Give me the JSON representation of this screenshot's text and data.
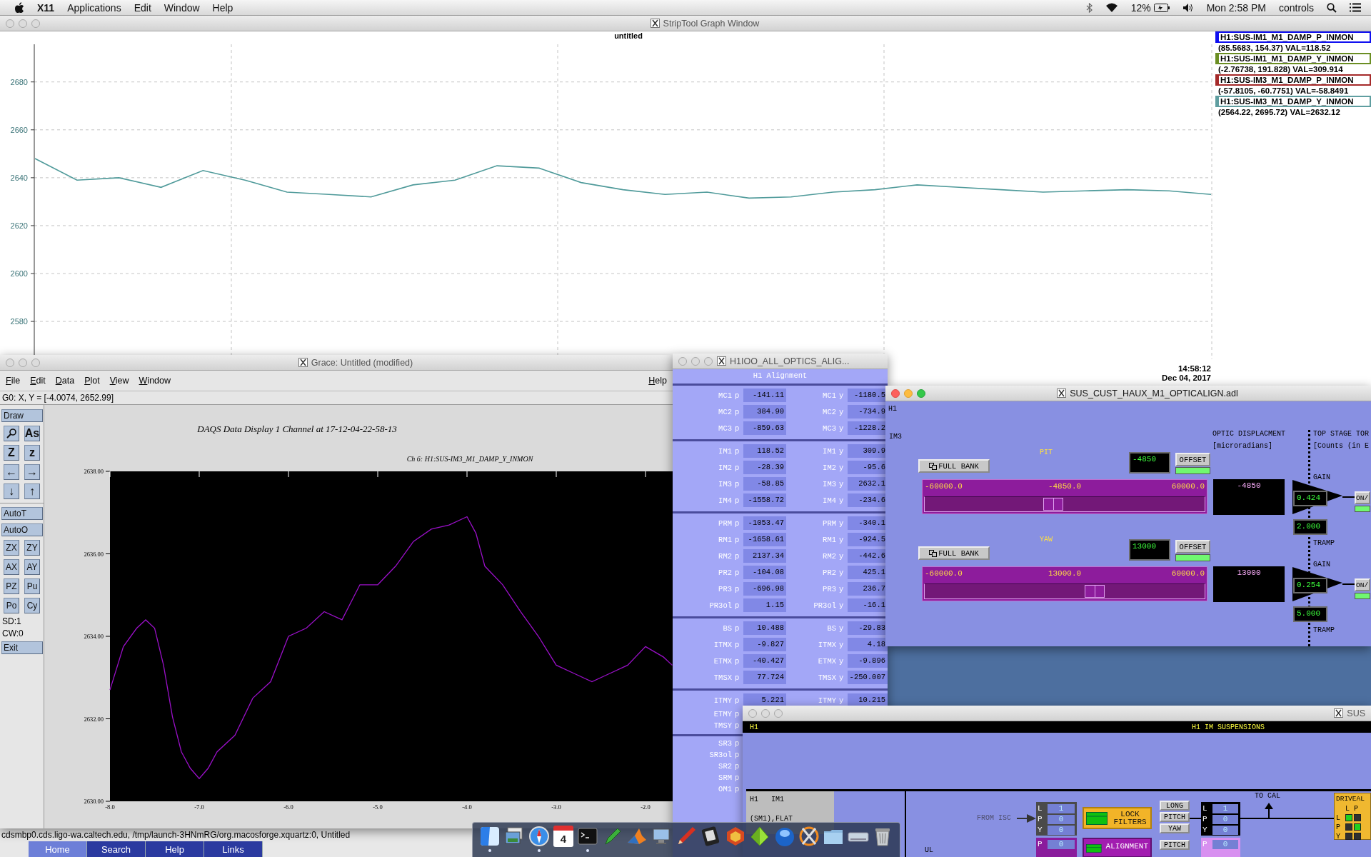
{
  "menu_bar": {
    "app": "X11",
    "menus": [
      "Applications",
      "Edit",
      "Window",
      "Help"
    ],
    "battery": "12%",
    "clock": "Mon 2:58 PM",
    "user": "controls"
  },
  "strip_tool": {
    "title": "StripTool Graph Window",
    "active": false,
    "subtitle": "untitled",
    "timestamp": "14:58:12",
    "date": "Dec 04, 2017",
    "chart_data": {
      "type": "line",
      "grid": true,
      "ylim": [
        2564.22,
        2695.72
      ],
      "yticks": [
        2580,
        2600,
        2620,
        2640,
        2660,
        2680
      ],
      "series": [
        {
          "color": "#4f9a9a",
          "values": [
            2648,
            2639,
            2640,
            2636,
            2643,
            2639,
            2634,
            2633,
            2632,
            2637,
            2639,
            2645,
            2644,
            2638,
            2635,
            2633,
            2634,
            2631.5,
            2632,
            2634,
            2635,
            2637,
            2636,
            2635,
            2634,
            2634.5,
            2635,
            2634.5,
            2633
          ]
        }
      ]
    },
    "legend": [
      {
        "name": "H1:SUS-IM1_M1_DAMP_P_INMON",
        "color": "#1010f0",
        "reading": "(85.5683, 154.37) VAL=118.52"
      },
      {
        "name": "H1:SUS-IM1_M1_DAMP_Y_INMON",
        "color": "#6b8e23",
        "reading": "(-2.76738, 191.828) VAL=309.914"
      },
      {
        "name": "H1:SUS-IM3_M1_DAMP_P_INMON",
        "color": "#a52a2a",
        "reading": "(-57.8105, -60.7751) VAL=-58.8491"
      },
      {
        "name": "H1:SUS-IM3_M1_DAMP_Y_INMON",
        "color": "#5f9ea0",
        "reading": "(2564.22, 2695.72) VAL=2632.12"
      }
    ]
  },
  "grace": {
    "title": "Grace: Untitled (modified)",
    "active": false,
    "menus": [
      "File",
      "Edit",
      "Data",
      "Plot",
      "View",
      "Window"
    ],
    "help": "Help",
    "coords": "G0: X, Y = [-4.0074, 2652.99]",
    "tools": [
      {
        "kind": "wide",
        "label": "Draw"
      },
      {
        "kind": "magnifier"
      },
      {
        "kind": "square",
        "label": "As"
      },
      {
        "kind": "square",
        "label": "Z"
      },
      {
        "kind": "square",
        "label": "z"
      },
      {
        "kind": "square",
        "label": "←"
      },
      {
        "kind": "square",
        "label": "→"
      },
      {
        "kind": "square",
        "label": "↓"
      },
      {
        "kind": "square",
        "label": "↑"
      },
      {
        "kind": "divider"
      },
      {
        "kind": "wide",
        "label": "AutoT"
      },
      {
        "kind": "wide",
        "label": "AutoO"
      },
      {
        "kind": "small",
        "label": "ZX"
      },
      {
        "kind": "small",
        "label": "ZY"
      },
      {
        "kind": "small",
        "label": "AX"
      },
      {
        "kind": "small",
        "label": "AY"
      },
      {
        "kind": "small",
        "label": "PZ"
      },
      {
        "kind": "small",
        "label": "Pu"
      },
      {
        "kind": "small",
        "label": "Po"
      },
      {
        "kind": "small",
        "label": "Cy"
      },
      {
        "kind": "info",
        "label": "SD:1"
      },
      {
        "kind": "info",
        "label": "CW:0"
      },
      {
        "kind": "wide",
        "label": "Exit"
      }
    ],
    "chart_data": {
      "type": "line",
      "title": "DAQS Data Display 1 Channel at 17-12-04-22-58-13",
      "xlim": [
        -8,
        -1.696
      ],
      "ylim": [
        2630,
        2638
      ],
      "xticks": [
        {
          "value": -8,
          "label": "-8.0"
        },
        {
          "value": -7,
          "label": "-7.0"
        },
        {
          "value": -6,
          "label": "-6.0"
        },
        {
          "value": -5,
          "label": "-5.0"
        },
        {
          "value": -4,
          "label": "-4.0"
        },
        {
          "value": -3,
          "label": "-3.0"
        },
        {
          "value": -2,
          "label": "-2.0"
        }
      ],
      "yticks": [
        {
          "value": 2630,
          "label": "2630.00"
        },
        {
          "value": 2632,
          "label": "2632.00"
        },
        {
          "value": 2634,
          "label": "2634.00"
        },
        {
          "value": 2636,
          "label": "2636.00"
        },
        {
          "value": 2638,
          "label": "2638.00"
        }
      ],
      "x": [
        -8,
        -7.85,
        -7.7,
        -7.6,
        -7.5,
        -7.4,
        -7.3,
        -7.2,
        -7.1,
        -7,
        -6.9,
        -6.8,
        -6.6,
        -6.4,
        -6.2,
        -6,
        -5.8,
        -5.6,
        -5.4,
        -5.2,
        -5,
        -4.8,
        -4.6,
        -4.4,
        -4.2,
        -4,
        -3.9,
        -3.8,
        -3.6,
        -3.4,
        -3.2,
        -3,
        -2.8,
        -2.6,
        -2.4,
        -2.2,
        -2,
        -1.8,
        -1.7
      ],
      "series": [
        {
          "name": "Ch 6:  H1:SUS-IM3_M1_DAMP_Y_INMON",
          "color": "#9a10c8",
          "values": [
            2632.7,
            2633.75,
            2634.2,
            2634.4,
            2634.2,
            2633.3,
            2632.05,
            2631.2,
            2630.8,
            2630.55,
            2630.8,
            2631.2,
            2631.6,
            2632.5,
            2632.9,
            2634,
            2634.2,
            2634.6,
            2634.4,
            2635.25,
            2635.25,
            2635.7,
            2636.3,
            2636.6,
            2636.7,
            2636.9,
            2636.5,
            2635.7,
            2635.25,
            2634.6,
            2634,
            2633.3,
            2633.1,
            2632.9,
            2633.1,
            2633.3,
            2633.75,
            2633.5,
            2633.3
          ]
        }
      ]
    }
  },
  "background_window": {
    "status": "cdsmbp0.cds.ligo-wa.caltech.edu, /tmp/launch-3HNmRG/org.macosforge.xquartz:0, Untitled",
    "nav": [
      {
        "label": "Home",
        "selected": true
      },
      {
        "label": "Search",
        "selected": false
      },
      {
        "label": "Help",
        "selected": false
      },
      {
        "label": "Links",
        "selected": false
      }
    ]
  },
  "alignment": {
    "title": "H1IOO_ALL_OPTICS_ALIG...",
    "active": false,
    "header": "H1 Alignment",
    "groups": [
      [
        {
          "cells": [
            {
              "label": "MC1",
              "axis": "p",
              "value": "-141.11"
            },
            {
              "label": "MC1",
              "axis": "y",
              "value": "-1180.5"
            }
          ]
        },
        {
          "cells": [
            {
              "label": "MC2",
              "axis": "p",
              "value": "384.90"
            },
            {
              "label": "MC2",
              "axis": "y",
              "value": "-734.9"
            }
          ]
        },
        {
          "cells": [
            {
              "label": "MC3",
              "axis": "p",
              "value": "-859.63"
            },
            {
              "label": "MC3",
              "axis": "y",
              "value": "-1228.2"
            }
          ]
        }
      ],
      [
        {
          "cells": [
            {
              "label": "IM1",
              "axis": "p",
              "value": "118.52"
            },
            {
              "label": "IM1",
              "axis": "y",
              "value": "309.9"
            }
          ]
        },
        {
          "cells": [
            {
              "label": "IM2",
              "axis": "p",
              "value": "-28.39"
            },
            {
              "label": "IM2",
              "axis": "y",
              "value": "-95.6"
            }
          ]
        },
        {
          "cells": [
            {
              "label": "IM3",
              "axis": "p",
              "value": "-58.85"
            },
            {
              "label": "IM3",
              "axis": "y",
              "value": "2632.1"
            }
          ]
        },
        {
          "cells": [
            {
              "label": "IM4",
              "axis": "p",
              "value": "-1558.72"
            },
            {
              "label": "IM4",
              "axis": "y",
              "value": "-234.6"
            }
          ]
        }
      ],
      [
        {
          "cells": [
            {
              "label": "PRM",
              "axis": "p",
              "value": "-1053.47"
            },
            {
              "label": "PRM",
              "axis": "y",
              "value": "-340.1"
            }
          ]
        },
        {
          "cells": [
            {
              "label": "RM1",
              "axis": "p",
              "value": "-1658.61"
            },
            {
              "label": "RM1",
              "axis": "y",
              "value": "-924.5"
            }
          ]
        },
        {
          "cells": [
            {
              "label": "RM2",
              "axis": "p",
              "value": "2137.34"
            },
            {
              "label": "RM2",
              "axis": "y",
              "value": "-442.6"
            }
          ]
        },
        {
          "cells": [
            {
              "label": "PR2",
              "axis": "p",
              "value": "-104.08"
            },
            {
              "label": "PR2",
              "axis": "y",
              "value": "425.1"
            }
          ]
        },
        {
          "cells": [
            {
              "label": "PR3",
              "axis": "p",
              "value": "-696.98"
            },
            {
              "label": "PR3",
              "axis": "y",
              "value": "236.7"
            }
          ]
        },
        {
          "cells": [
            {
              "label": "PR3ol",
              "axis": "p",
              "value": "1.15"
            },
            {
              "label": "PR3ol",
              "axis": "y",
              "value": "-16.1"
            }
          ]
        }
      ],
      [
        {
          "cells": [
            {
              "label": "BS",
              "axis": "p",
              "value": "10.488"
            },
            {
              "label": "BS",
              "axis": "y",
              "value": "-29.83"
            }
          ]
        },
        {
          "cells": [
            {
              "label": "ITMX",
              "axis": "p",
              "value": "-9.827"
            },
            {
              "label": "ITMX",
              "axis": "y",
              "value": "4.18"
            }
          ]
        },
        {
          "cells": [
            {
              "label": "ETMX",
              "axis": "p",
              "value": "-40.427"
            },
            {
              "label": "ETMX",
              "axis": "y",
              "value": "-9.896"
            }
          ]
        },
        {
          "cells": [
            {
              "label": "TMSX",
              "axis": "p",
              "value": "77.724"
            },
            {
              "label": "TMSX",
              "axis": "y",
              "value": "-250.007"
            }
          ]
        }
      ],
      [
        {
          "cells": [
            {
              "label": "ITMY",
              "axis": "p",
              "value": "5.221"
            },
            {
              "label": "ITMY",
              "axis": "y",
              "value": "10.215"
            }
          ]
        },
        {
          "cells": [
            {
              "label": "ETMY",
              "axis": "p"
            }
          ]
        },
        {
          "cells": [
            {
              "label": "TMSY",
              "axis": "p"
            }
          ]
        }
      ],
      [
        {
          "cells": [
            {
              "label": "SR3",
              "axis": "p"
            }
          ]
        },
        {
          "cells": [
            {
              "label": "SR3ol",
              "axis": "p"
            }
          ]
        },
        {
          "cells": [
            {
              "label": "SR2",
              "axis": "p"
            }
          ]
        },
        {
          "cells": [
            {
              "label": "SRM",
              "axis": "p"
            }
          ]
        },
        {
          "cells": [
            {
              "label": "OM1",
              "axis": "p"
            }
          ]
        }
      ]
    ]
  },
  "optic_align": {
    "title": "SUS_CUST_HAUX_M1_OPTICALIGN.adl",
    "active": true,
    "site": "H1",
    "stage": "IM3",
    "displacement_title": "OPTIC DISPLACMENT",
    "displacement_unit": "[microradians]",
    "torque_title": "TOP STAGE TOR",
    "torque_unit": "[Counts (in E",
    "channels": [
      {
        "name": "PIT",
        "bank_button": "FULL BANK",
        "setpoint": "-4850",
        "offset_button": "OFFSET",
        "offset_on": true,
        "min": "-60000.0",
        "current": "-4850.0",
        "max": "60000.0",
        "level": 0.46,
        "display": "-4850",
        "gain_label": "GAIN",
        "gain": "0.424",
        "tramp": "2.000",
        "tramp_label": "TRAMP",
        "switch": "ON/"
      },
      {
        "name": "YAW",
        "bank_button": "FULL BANK",
        "setpoint": "13000",
        "offset_button": "OFFSET",
        "offset_on": true,
        "min": "-60000.0",
        "current": "13000.0",
        "max": "60000.0",
        "level": 0.608,
        "display": "13000",
        "gain_label": "GAIN",
        "gain": "0.254",
        "tramp": "5.000",
        "tramp_label": "TRAMP",
        "switch": "ON/"
      }
    ]
  },
  "im_suspensions": {
    "title": "SUS",
    "active": false,
    "site": "H1",
    "heading": "H1 IM SUSPENSIONS",
    "box_title": [
      "H1",
      "IM1"
    ],
    "filter_state": "(SM1),FLAT",
    "source": "FROM ISC",
    "ul": "UL",
    "input": [
      {
        "axis": "L",
        "value": "1"
      },
      {
        "axis": "P",
        "value": "0"
      },
      {
        "axis": "Y",
        "value": "0"
      }
    ],
    "lock_button": "LOCK FILTERS",
    "dof_buttons": [
      "LONG",
      "PITCH",
      "YAW"
    ],
    "output": [
      {
        "axis": "L",
        "value": "1"
      },
      {
        "axis": "P",
        "value": "0"
      },
      {
        "axis": "Y",
        "value": "0"
      }
    ],
    "to_cal": "TO CAL",
    "drive_title": "DRIVEAL",
    "drive_columns": [
      "L",
      "P"
    ],
    "drive_matrix": [
      {
        "axis": "L",
        "cells": [
          true,
          false
        ]
      },
      {
        "axis": "P",
        "cells": [
          false,
          true
        ]
      },
      {
        "axis": "Y",
        "cells": [
          false,
          false
        ]
      }
    ],
    "offset_row": {
      "input": {
        "axis": "P",
        "value": "0"
      },
      "button": "ALIGNMENT",
      "dof_button": "PITCH",
      "output": {
        "axis": "P",
        "value": "0"
      }
    }
  },
  "dock": [
    {
      "kind": "finder",
      "running": true
    },
    {
      "kind": "preview"
    },
    {
      "kind": "compass",
      "running": true
    },
    {
      "kind": "calendar",
      "label": "4"
    },
    {
      "kind": "terminal",
      "running": true
    },
    {
      "kind": "pen"
    },
    {
      "kind": "peak"
    },
    {
      "kind": "monitor"
    },
    {
      "kind": "pencil"
    },
    {
      "kind": "tablet"
    },
    {
      "kind": "hexagon"
    },
    {
      "kind": "pyramid"
    },
    {
      "kind": "sphere"
    },
    {
      "kind": "xmark"
    },
    {
      "kind": "folder"
    },
    {
      "kind": "drive"
    },
    {
      "kind": "trash"
    }
  ]
}
